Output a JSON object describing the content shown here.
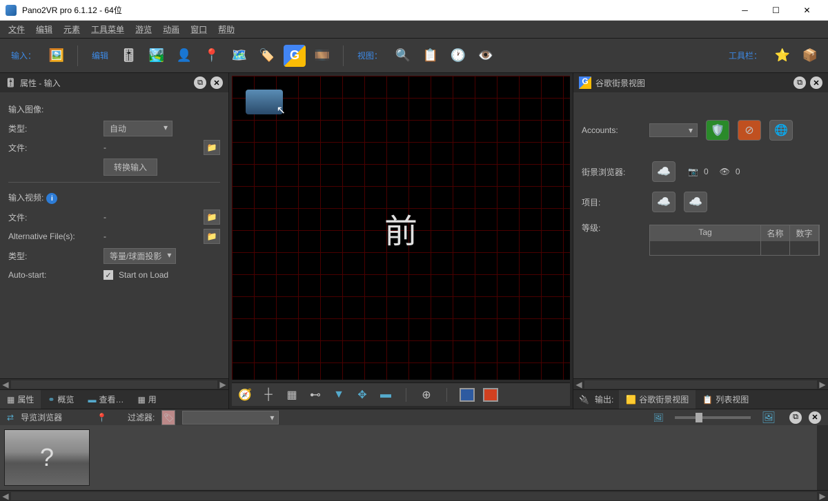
{
  "window": {
    "title": "Pano2VR pro 6.1.12 - 64位"
  },
  "menu": {
    "file": "文件",
    "edit": "编辑",
    "element": "元素",
    "tools": "工具菜单",
    "tour": "游览",
    "anim": "动画",
    "window": "窗口",
    "help": "帮助"
  },
  "toolbar": {
    "input": "输入：",
    "edit": "编辑",
    "view": "视图：",
    "toolbar": "工具栏："
  },
  "leftpanel": {
    "title": "属性 - 输入",
    "inputImage": "输入图像:",
    "type": "类型:",
    "typeVal": "自动",
    "file": "文件:",
    "fileVal": "-",
    "convert": "转换输入",
    "inputVideo": "输入视频:",
    "file2": "文件:",
    "file2Val": "-",
    "altFiles": "Alternative File(s):",
    "altVal": "-",
    "type2": "类型:",
    "type2Val": "等量/球面投影",
    "autostart": "Auto-start:",
    "startOnLoad": "Start on Load"
  },
  "leftTabs": {
    "props": "属性",
    "overview": "概览",
    "view": "查看…",
    "use": "用"
  },
  "canvas": {
    "label": "前"
  },
  "rightpanel": {
    "title": "谷歌街景视图",
    "accounts": "Accounts:",
    "browser": "街景浏览器:",
    "cam": "0",
    "eye": "0",
    "project": "项目:",
    "level": "等级:",
    "th_tag": "Tag",
    "th_name": "名称",
    "th_num": "数字",
    "output": "输出:"
  },
  "rightTabs": {
    "gsv": "谷歌街景视图",
    "list": "列表视图"
  },
  "bottom": {
    "title": "导览浏览器",
    "filter": "过滤器:"
  }
}
